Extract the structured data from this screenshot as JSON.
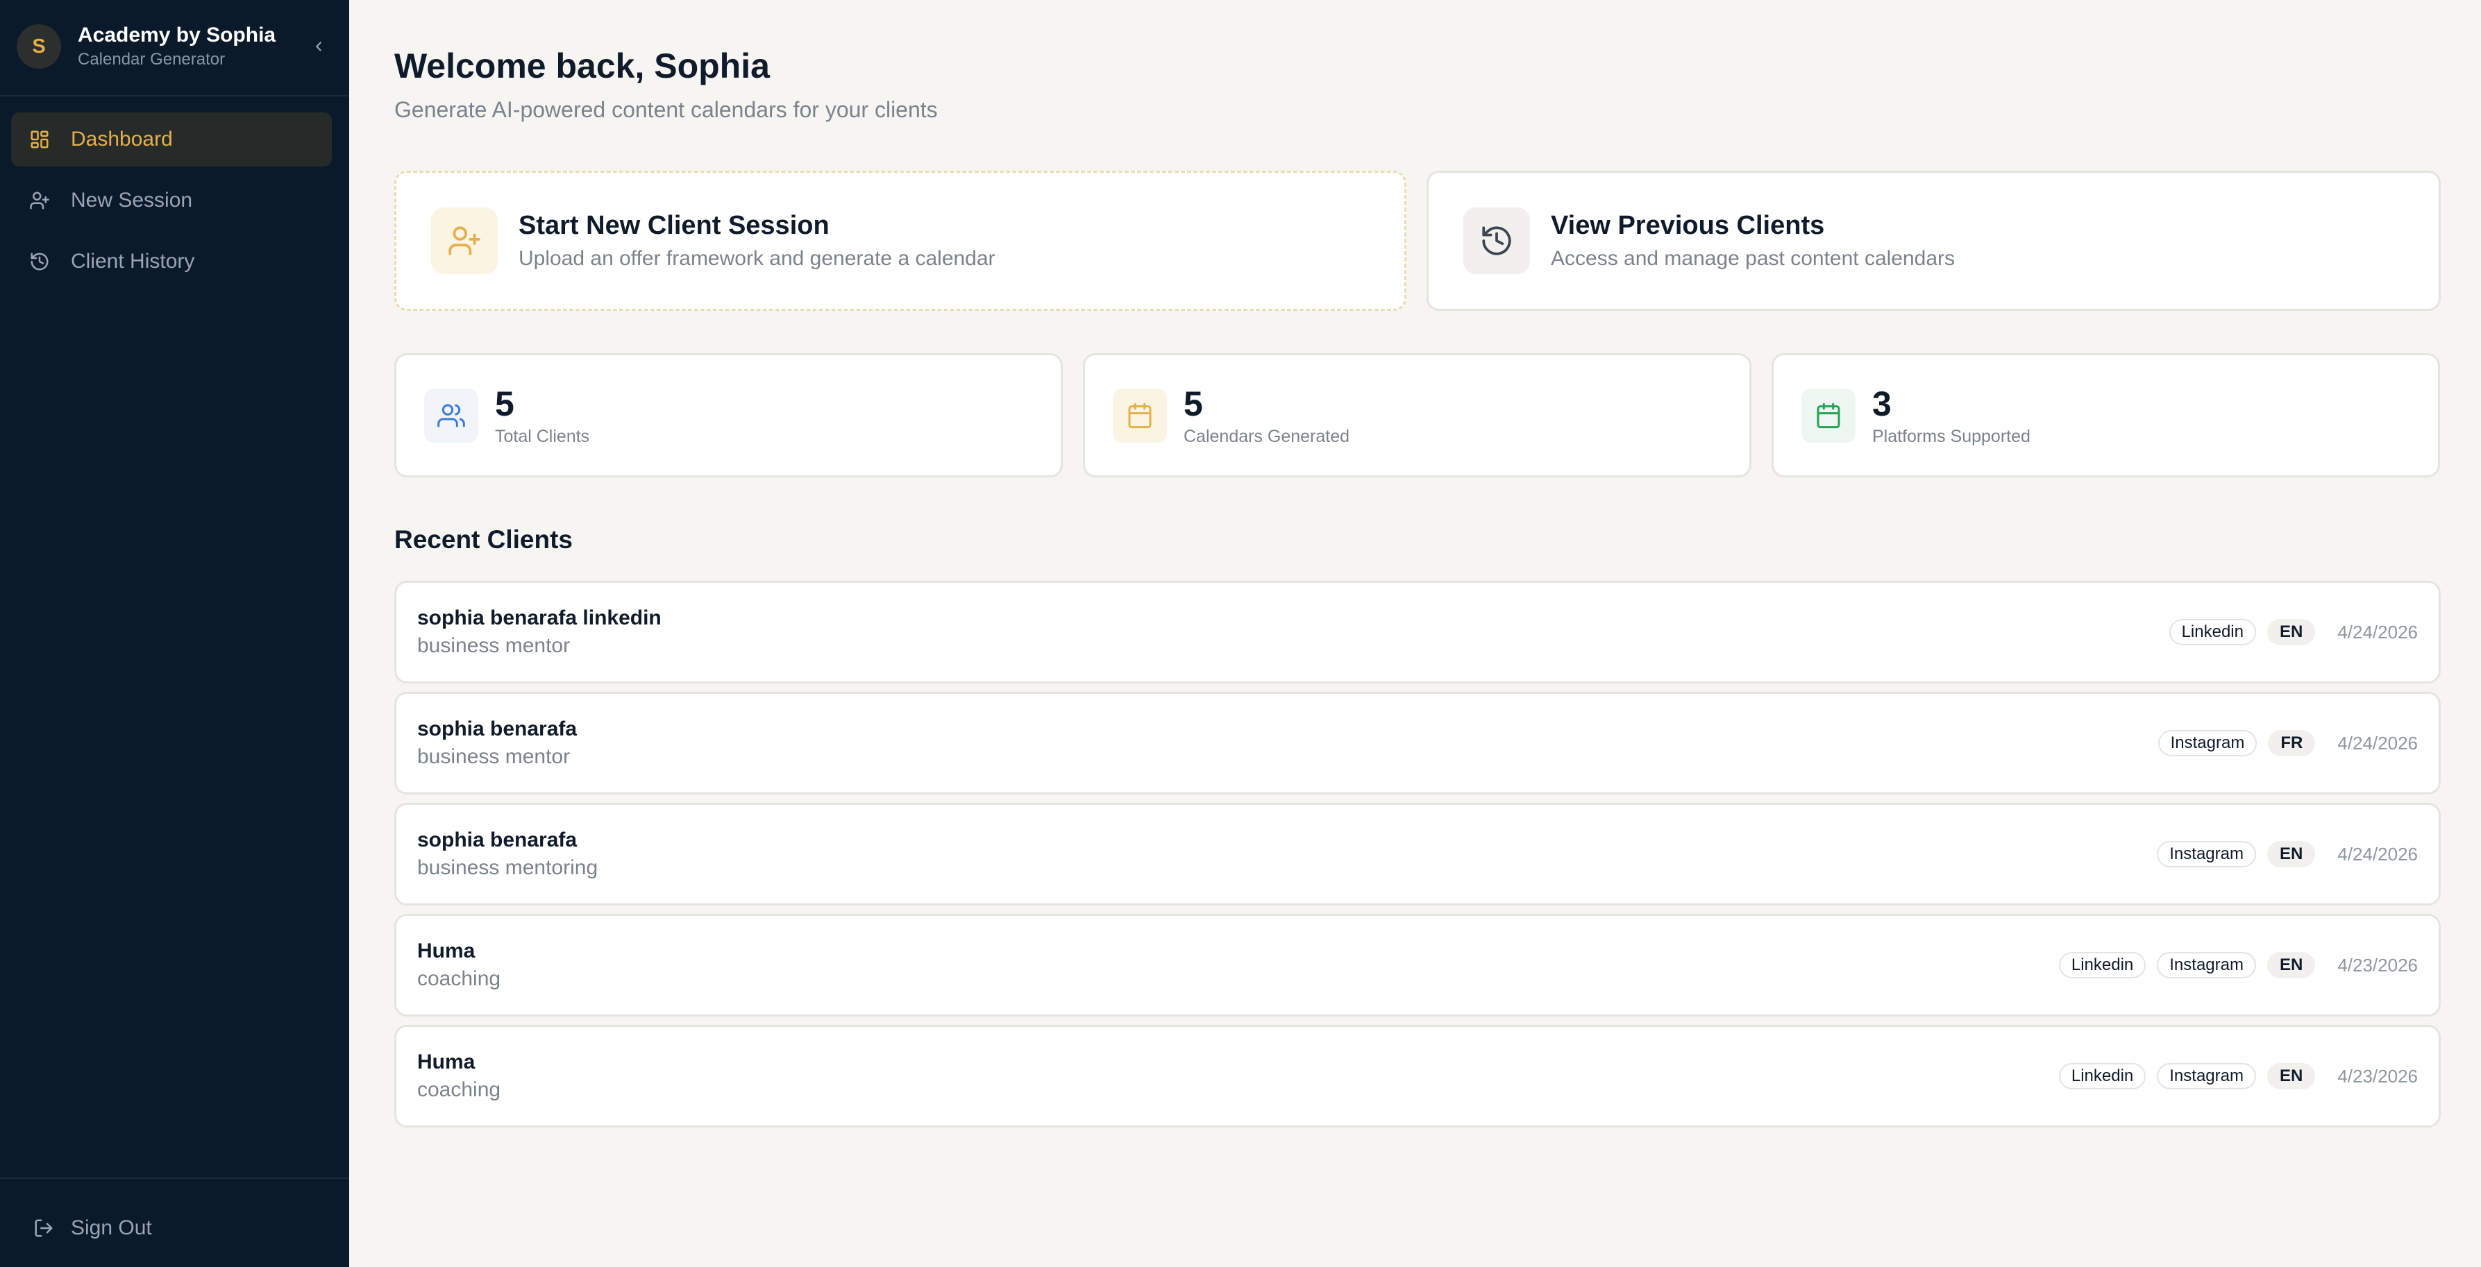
{
  "brand": {
    "initial": "S",
    "name": "Academy by Sophia",
    "subtitle": "Calendar Generator"
  },
  "nav": {
    "items": [
      {
        "label": "Dashboard",
        "icon": "dashboard-icon",
        "active": true
      },
      {
        "label": "New Session",
        "icon": "user-plus-icon",
        "active": false
      },
      {
        "label": "Client History",
        "icon": "history-icon",
        "active": false
      }
    ],
    "sign_out": "Sign Out"
  },
  "header": {
    "title": "Welcome back, Sophia",
    "subtitle": "Generate AI-powered content calendars for your clients"
  },
  "actions": {
    "new_session": {
      "title": "Start New Client Session",
      "description": "Upload an offer framework and generate a calendar"
    },
    "previous_clients": {
      "title": "View Previous Clients",
      "description": "Access and manage past content calendars"
    }
  },
  "stats": [
    {
      "value": "5",
      "label": "Total Clients"
    },
    {
      "value": "5",
      "label": "Calendars Generated"
    },
    {
      "value": "3",
      "label": "Platforms Supported"
    }
  ],
  "recent": {
    "title": "Recent Clients",
    "clients": [
      {
        "name": "sophia benarafa linkedin",
        "niche": "business mentor",
        "platforms": [
          "Linkedin"
        ],
        "lang": "EN",
        "date": "4/24/2026"
      },
      {
        "name": "sophia benarafa",
        "niche": "business mentor",
        "platforms": [
          "Instagram"
        ],
        "lang": "FR",
        "date": "4/24/2026"
      },
      {
        "name": "sophia benarafa",
        "niche": "business mentoring",
        "platforms": [
          "Instagram"
        ],
        "lang": "EN",
        "date": "4/24/2026"
      },
      {
        "name": "Huma",
        "niche": "coaching",
        "platforms": [
          "Linkedin",
          "Instagram"
        ],
        "lang": "EN",
        "date": "4/23/2026"
      },
      {
        "name": "Huma",
        "niche": "coaching",
        "platforms": [
          "Linkedin",
          "Instagram"
        ],
        "lang": "EN",
        "date": "4/23/2026"
      }
    ]
  },
  "colors": {
    "sidebar_bg": "#0a1a2a",
    "accent_gold": "#e3b04b",
    "page_bg": "#f6f5f2",
    "stat_blue": "#3b7dd8",
    "stat_green": "#22a455"
  }
}
